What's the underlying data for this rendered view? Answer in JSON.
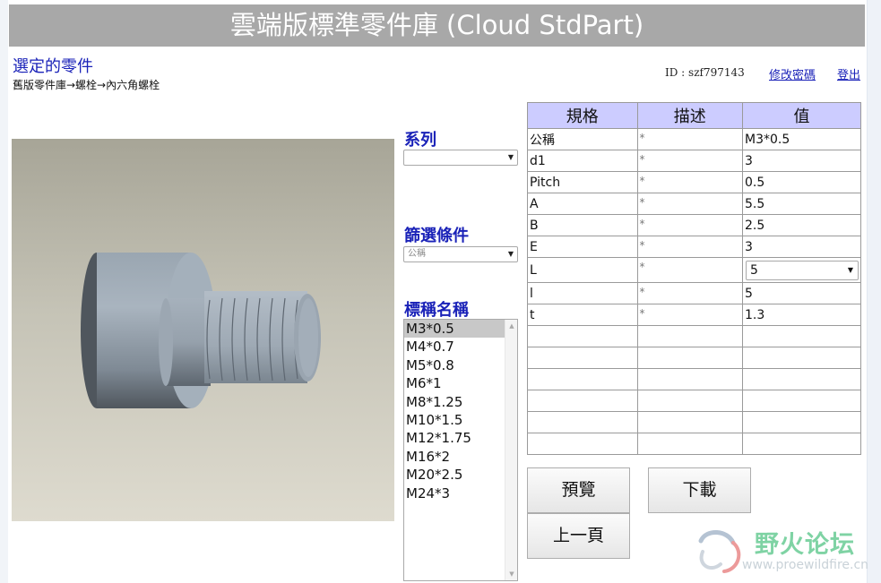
{
  "header": {
    "title": "雲端版標準零件庫 (Cloud StdPart)"
  },
  "selected_part": {
    "title": "選定的零件",
    "breadcrumb": "舊版零件庫→螺栓→內六角螺栓"
  },
  "user": {
    "id_label": "ID : szf797143",
    "change_password": "修改密碼",
    "logout": "登出"
  },
  "filters": {
    "series_label": "系列",
    "series_value": "",
    "filter_label": "篩選條件",
    "filter_value": "公稱",
    "name_label": "標稱名稱",
    "names": [
      "M3*0.5",
      "M4*0.7",
      "M5*0.8",
      "M6*1",
      "M8*1.25",
      "M10*1.5",
      "M12*1.75",
      "M16*2",
      "M20*2.5",
      "M24*3"
    ],
    "selected_name": "M3*0.5"
  },
  "spec_table": {
    "headers": [
      "規格",
      "描述",
      "值"
    ],
    "rows": [
      {
        "spec": "公稱",
        "desc": "*",
        "value": "M3*0.5"
      },
      {
        "spec": "d1",
        "desc": "*",
        "value": "3"
      },
      {
        "spec": "Pitch",
        "desc": "*",
        "value": "0.5"
      },
      {
        "spec": "A",
        "desc": "*",
        "value": "5.5"
      },
      {
        "spec": "B",
        "desc": "*",
        "value": "2.5"
      },
      {
        "spec": "E",
        "desc": "*",
        "value": "3"
      },
      {
        "spec": "L",
        "desc": "*",
        "value": "5",
        "is_select": true
      },
      {
        "spec": "l",
        "desc": "*",
        "value": "5"
      },
      {
        "spec": "t",
        "desc": "*",
        "value": "1.3"
      }
    ],
    "empty_rows": 6
  },
  "buttons": {
    "preview": "預覽",
    "download": "下載",
    "back": "上一頁"
  },
  "watermark": {
    "name": "野火论坛",
    "url": "www.proewildfire.cn"
  },
  "icons": {
    "dropdown_arrow": "▼",
    "scroll_up": "▲",
    "scroll_down": "▼"
  }
}
